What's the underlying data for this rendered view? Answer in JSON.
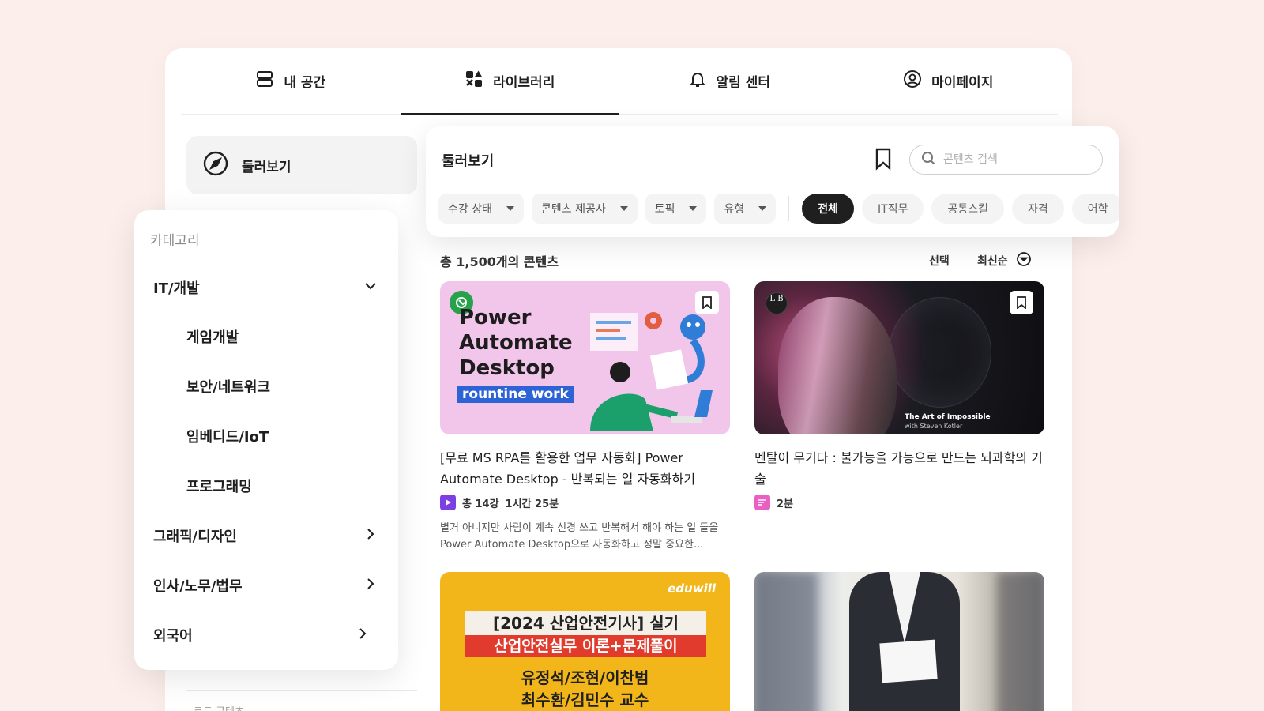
{
  "nav": {
    "tabs": [
      {
        "label": "내 공간",
        "icon": "layout-icon"
      },
      {
        "label": "라이브러리",
        "icon": "library-icon",
        "active": true
      },
      {
        "label": "알림 센터",
        "icon": "bell-icon"
      },
      {
        "label": "마이페이지",
        "icon": "user-circle-icon"
      }
    ]
  },
  "sidebar": {
    "browse_label": "둘러보기",
    "footer_text": "코드 콘텐츠"
  },
  "category": {
    "title": "카테고리",
    "items": [
      {
        "label": "IT/개발",
        "expanded": true
      },
      {
        "label": "게임개발"
      },
      {
        "label": "보안/네트워크"
      },
      {
        "label": "임베디드/IoT"
      },
      {
        "label": "프로그래밍"
      },
      {
        "label": "그래픽/디자인"
      },
      {
        "label": "인사/노무/법무"
      },
      {
        "label": "외국어"
      }
    ]
  },
  "header": {
    "title": "둘러보기",
    "search_placeholder": "콘텐츠 검색",
    "filters": [
      "수강 상태",
      "콘텐츠 제공사",
      "토픽",
      "유형"
    ],
    "chips": [
      "전체",
      "IT직무",
      "공통스킬",
      "자격",
      "어학"
    ],
    "active_chip": "전체"
  },
  "content": {
    "count": "총 1,500개의 콘텐츠",
    "select_label": "선택",
    "sort_label": "최신순"
  },
  "cards": [
    {
      "thumb_title_lines": [
        "Power",
        "Automate",
        "Desktop"
      ],
      "thumb_tag": "rountine work",
      "title": "[무료 MS RPA를 활용한 업무 자동화] Power Automate Desktop - 반복되는 일 자동화하기",
      "meta_lessons": "총 14강",
      "meta_duration": "1시간 25분",
      "description": "별거 아니지만 사람이 계속 신경 쓰고 반복해서 해야 하는 일 들을 Power Automate Desktop으로 자동화하고 정말 중요한...",
      "badge_color": "#7b3fe4"
    },
    {
      "thumb_logo": "L B",
      "thumb_caption": "The Art of Impossible",
      "thumb_caption_sub": "with Steven Kotler",
      "title": "멘탈이 무기다 : 불가능을 가능으로 만드는 뇌과학의 기술",
      "meta_duration": "2분",
      "badge_color": "#ea5fc2"
    },
    {
      "thumb_brand": "eduwill",
      "thumb_line1": "[2024 산업안전기사] 실기",
      "thumb_line2": "산업안전실무 이론+문제풀이",
      "thumb_line3": "유정석/조현/이찬범",
      "thumb_line4": "최수환/김민수 교수"
    },
    {}
  ]
}
